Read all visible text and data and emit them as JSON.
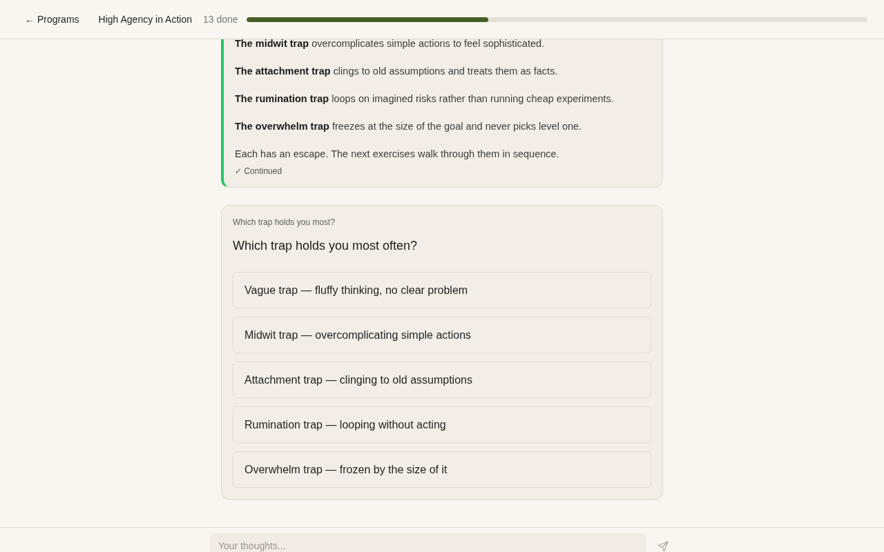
{
  "header": {
    "back_link": "← Programs",
    "title": "High Agency in Action",
    "progress": {
      "label": "13 done",
      "level": 0.39
    }
  },
  "lesson_card": {
    "paragraphs": [
      "**The midwit trap** overcomplicates simple actions to feel sophisticated.",
      "**The attachment trap** clings to old assumptions and treats them as facts.",
      "**The rumination trap** loops on imagined risks rather than running cheap experiments.",
      "**The overwhelm trap** freezes at the size of the goal and never picks level one.",
      "Each has an escape. The next exercises walk through them in sequence."
    ],
    "status": "✓ Continued"
  },
  "question_card": {
    "label": "Which trap holds you most?",
    "question": "Which trap holds you most often?",
    "options": [
      {
        "text": "Vague trap — fluffy thinking, no clear problem",
        "selected": false
      },
      {
        "text": "Midwit trap — overcomplicating simple actions",
        "selected": false
      },
      {
        "text": "Attachment trap — clinging to old assumptions",
        "selected": false
      },
      {
        "text": "Rumination trap — looping without acting",
        "selected": false
      },
      {
        "text": "Overwhelm trap — frozen by the size of it",
        "selected": false
      }
    ]
  },
  "composer": {
    "placeholder": "Your thoughts..."
  }
}
